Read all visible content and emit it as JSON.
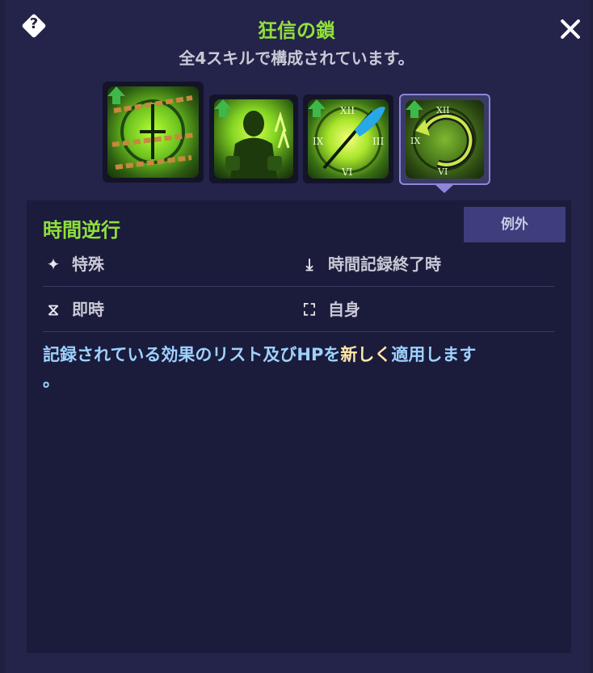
{
  "header": {
    "title": "狂信の鎖",
    "subtitle": "全4スキルで構成されています。",
    "help_icon": "question-diamond-icon",
    "close_icon": "close-icon"
  },
  "skills": [
    {
      "name": "chain-clock-skill-icon",
      "selected": false,
      "upgrade": true
    },
    {
      "name": "fist-aura-skill-icon",
      "selected": false,
      "upgrade": true
    },
    {
      "name": "clock-feather-skill-icon",
      "selected": false,
      "upgrade": true
    },
    {
      "name": "rewind-clock-skill-icon",
      "selected": true,
      "upgrade": true
    }
  ],
  "detail": {
    "skill_name": "時間逆行",
    "tag": "例外",
    "row1": {
      "left_label": "特殊",
      "left_icon": "sparkle-icon",
      "right_label": "時間記録終了時",
      "right_icon": "download-icon"
    },
    "row2": {
      "left_label": "即時",
      "left_icon": "hourglass-icon",
      "right_label": "自身",
      "right_icon": "self-target-icon"
    },
    "description": {
      "part1": "記録されている効果のリスト及びHPを",
      "highlight": "新しく",
      "part2": "適用します",
      "part3": "。"
    }
  },
  "colors": {
    "accent_green": "#8fe13a",
    "description_blue": "#9ed2ff",
    "highlight": "#ffe9a8",
    "panel": "#24234a"
  }
}
